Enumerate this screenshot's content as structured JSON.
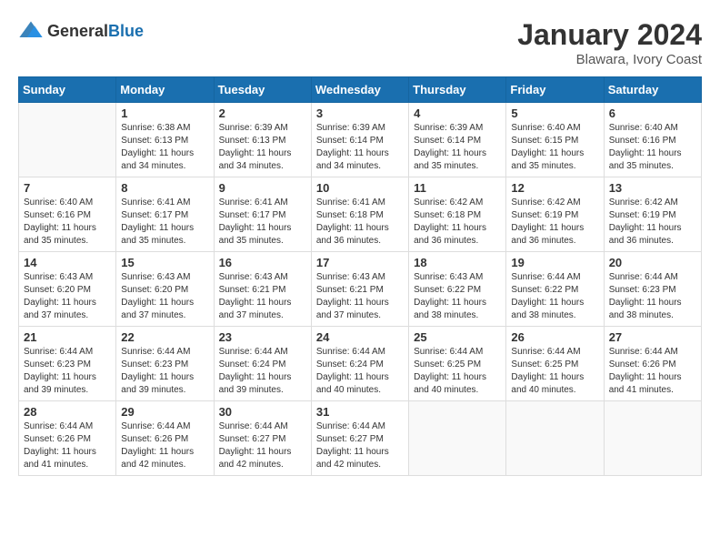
{
  "header": {
    "logo_general": "General",
    "logo_blue": "Blue",
    "month_year": "January 2024",
    "location": "Blawara, Ivory Coast"
  },
  "days_of_week": [
    "Sunday",
    "Monday",
    "Tuesday",
    "Wednesday",
    "Thursday",
    "Friday",
    "Saturday"
  ],
  "weeks": [
    [
      {
        "day": "",
        "sunrise": "",
        "sunset": "",
        "daylight": ""
      },
      {
        "day": "1",
        "sunrise": "6:38 AM",
        "sunset": "6:13 PM",
        "daylight": "11 hours and 34 minutes."
      },
      {
        "day": "2",
        "sunrise": "6:39 AM",
        "sunset": "6:13 PM",
        "daylight": "11 hours and 34 minutes."
      },
      {
        "day": "3",
        "sunrise": "6:39 AM",
        "sunset": "6:14 PM",
        "daylight": "11 hours and 34 minutes."
      },
      {
        "day": "4",
        "sunrise": "6:39 AM",
        "sunset": "6:14 PM",
        "daylight": "11 hours and 35 minutes."
      },
      {
        "day": "5",
        "sunrise": "6:40 AM",
        "sunset": "6:15 PM",
        "daylight": "11 hours and 35 minutes."
      },
      {
        "day": "6",
        "sunrise": "6:40 AM",
        "sunset": "6:16 PM",
        "daylight": "11 hours and 35 minutes."
      }
    ],
    [
      {
        "day": "7",
        "sunrise": "6:40 AM",
        "sunset": "6:16 PM",
        "daylight": "11 hours and 35 minutes."
      },
      {
        "day": "8",
        "sunrise": "6:41 AM",
        "sunset": "6:17 PM",
        "daylight": "11 hours and 35 minutes."
      },
      {
        "day": "9",
        "sunrise": "6:41 AM",
        "sunset": "6:17 PM",
        "daylight": "11 hours and 35 minutes."
      },
      {
        "day": "10",
        "sunrise": "6:41 AM",
        "sunset": "6:18 PM",
        "daylight": "11 hours and 36 minutes."
      },
      {
        "day": "11",
        "sunrise": "6:42 AM",
        "sunset": "6:18 PM",
        "daylight": "11 hours and 36 minutes."
      },
      {
        "day": "12",
        "sunrise": "6:42 AM",
        "sunset": "6:19 PM",
        "daylight": "11 hours and 36 minutes."
      },
      {
        "day": "13",
        "sunrise": "6:42 AM",
        "sunset": "6:19 PM",
        "daylight": "11 hours and 36 minutes."
      }
    ],
    [
      {
        "day": "14",
        "sunrise": "6:43 AM",
        "sunset": "6:20 PM",
        "daylight": "11 hours and 37 minutes."
      },
      {
        "day": "15",
        "sunrise": "6:43 AM",
        "sunset": "6:20 PM",
        "daylight": "11 hours and 37 minutes."
      },
      {
        "day": "16",
        "sunrise": "6:43 AM",
        "sunset": "6:21 PM",
        "daylight": "11 hours and 37 minutes."
      },
      {
        "day": "17",
        "sunrise": "6:43 AM",
        "sunset": "6:21 PM",
        "daylight": "11 hours and 37 minutes."
      },
      {
        "day": "18",
        "sunrise": "6:43 AM",
        "sunset": "6:22 PM",
        "daylight": "11 hours and 38 minutes."
      },
      {
        "day": "19",
        "sunrise": "6:44 AM",
        "sunset": "6:22 PM",
        "daylight": "11 hours and 38 minutes."
      },
      {
        "day": "20",
        "sunrise": "6:44 AM",
        "sunset": "6:23 PM",
        "daylight": "11 hours and 38 minutes."
      }
    ],
    [
      {
        "day": "21",
        "sunrise": "6:44 AM",
        "sunset": "6:23 PM",
        "daylight": "11 hours and 39 minutes."
      },
      {
        "day": "22",
        "sunrise": "6:44 AM",
        "sunset": "6:23 PM",
        "daylight": "11 hours and 39 minutes."
      },
      {
        "day": "23",
        "sunrise": "6:44 AM",
        "sunset": "6:24 PM",
        "daylight": "11 hours and 39 minutes."
      },
      {
        "day": "24",
        "sunrise": "6:44 AM",
        "sunset": "6:24 PM",
        "daylight": "11 hours and 40 minutes."
      },
      {
        "day": "25",
        "sunrise": "6:44 AM",
        "sunset": "6:25 PM",
        "daylight": "11 hours and 40 minutes."
      },
      {
        "day": "26",
        "sunrise": "6:44 AM",
        "sunset": "6:25 PM",
        "daylight": "11 hours and 40 minutes."
      },
      {
        "day": "27",
        "sunrise": "6:44 AM",
        "sunset": "6:26 PM",
        "daylight": "11 hours and 41 minutes."
      }
    ],
    [
      {
        "day": "28",
        "sunrise": "6:44 AM",
        "sunset": "6:26 PM",
        "daylight": "11 hours and 41 minutes."
      },
      {
        "day": "29",
        "sunrise": "6:44 AM",
        "sunset": "6:26 PM",
        "daylight": "11 hours and 42 minutes."
      },
      {
        "day": "30",
        "sunrise": "6:44 AM",
        "sunset": "6:27 PM",
        "daylight": "11 hours and 42 minutes."
      },
      {
        "day": "31",
        "sunrise": "6:44 AM",
        "sunset": "6:27 PM",
        "daylight": "11 hours and 42 minutes."
      },
      {
        "day": "",
        "sunrise": "",
        "sunset": "",
        "daylight": ""
      },
      {
        "day": "",
        "sunrise": "",
        "sunset": "",
        "daylight": ""
      },
      {
        "day": "",
        "sunrise": "",
        "sunset": "",
        "daylight": ""
      }
    ]
  ],
  "labels": {
    "sunrise": "Sunrise:",
    "sunset": "Sunset:",
    "daylight": "Daylight:"
  }
}
